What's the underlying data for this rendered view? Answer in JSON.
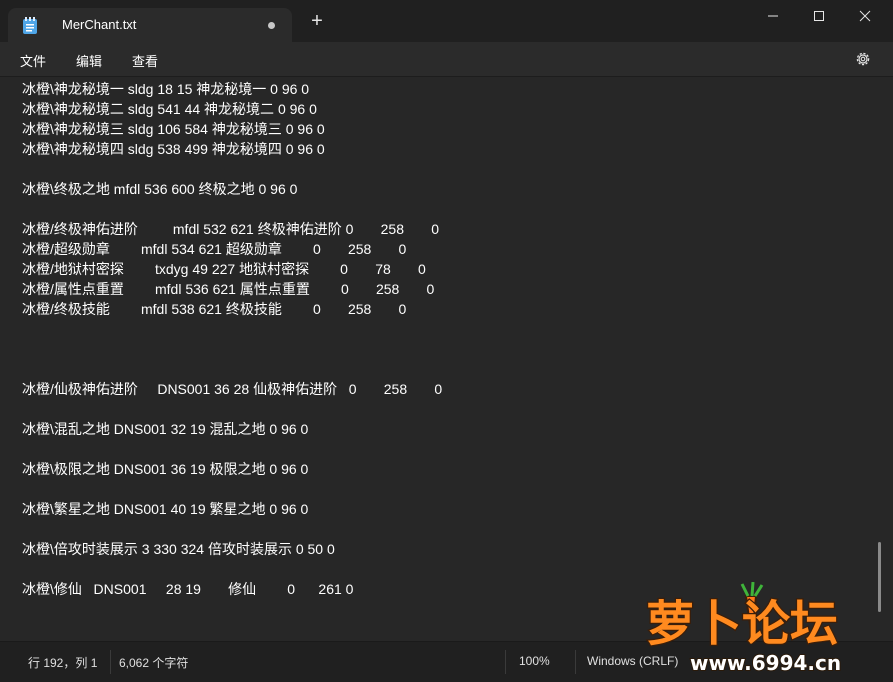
{
  "window": {
    "tab_title": "MerChant.txt",
    "new_tab": "+"
  },
  "menu": {
    "file": "文件",
    "edit": "编辑",
    "view": "查看"
  },
  "editor": {
    "lines": [
      "冰橙\\神龙秘境一 sldg 18 15 神龙秘境一 0 96 0",
      "冰橙\\神龙秘境二 sldg 541 44 神龙秘境二 0 96 0",
      "冰橙\\神龙秘境三 sldg 106 584 神龙秘境三 0 96 0",
      "冰橙\\神龙秘境四 sldg 538 499 神龙秘境四 0 96 0",
      "",
      "冰橙\\终极之地 mfdl 536 600 终极之地 0 96 0",
      "",
      "冰橙/终极神佑进阶         mfdl 532 621 终极神佑进阶 0       258       0",
      "冰橙/超级勋章        mfdl 534 621 超级勋章        0       258       0",
      "冰橙/地狱村密探        txdyg 49 227 地狱村密探        0       78       0",
      "冰橙/属性点重置        mfdl 536 621 属性点重置        0       258       0",
      "冰橙/终极技能        mfdl 538 621 终极技能        0       258       0",
      "",
      "",
      "",
      "冰橙/仙极神佑进阶     DNS001 36 28 仙极神佑进阶   0       258       0",
      "",
      "冰橙\\混乱之地 DNS001 32 19 混乱之地 0 96 0",
      "",
      "冰橙\\极限之地 DNS001 36 19 极限之地 0 96 0",
      "",
      "冰橙\\繁星之地 DNS001 40 19 繁星之地 0 96 0",
      "",
      "冰橙\\倍攻时装展示 3 330 324 倍攻时装展示 0 50 0",
      "",
      "冰橙\\修仙   DNS001     28 19       修仙        0      261 0"
    ]
  },
  "status": {
    "position": "行 192，列 1",
    "chars": "6,062 个字符",
    "zoom": "100%",
    "line_ending": "Windows (CRLF)"
  },
  "watermark": {
    "brand": "萝卜论坛",
    "url": "www.6994.cn"
  },
  "colors": {
    "background": "#202020",
    "editor_bg": "#272727",
    "tab_bg": "#2b2b2b",
    "text": "#ffffff",
    "brand_orange": "#ff8a1f"
  }
}
